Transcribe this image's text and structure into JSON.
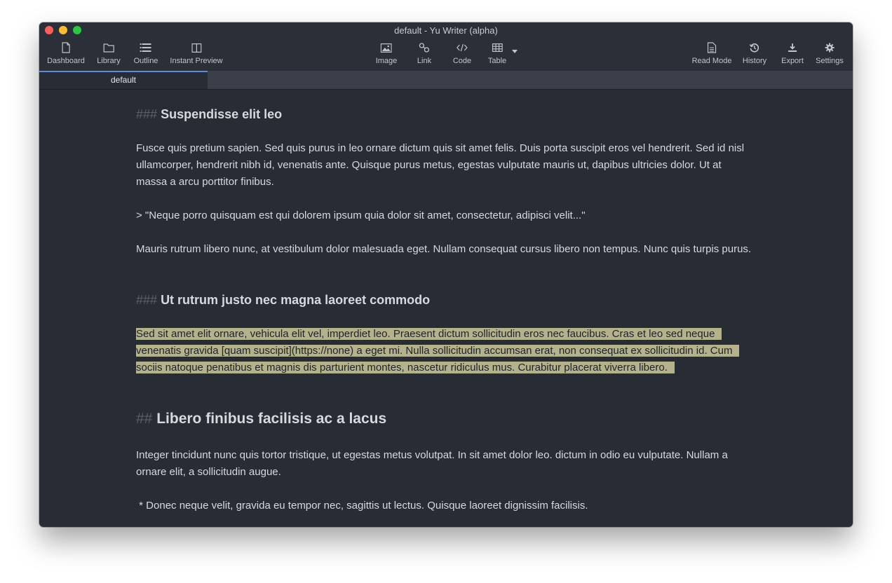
{
  "window": {
    "title": "default - Yu Writer (alpha)"
  },
  "toolbar": {
    "left": [
      {
        "label": "Dashboard",
        "icon": "document-icon"
      },
      {
        "label": "Library",
        "icon": "folder-icon"
      },
      {
        "label": "Outline",
        "icon": "list-icon"
      },
      {
        "label": "Instant Preview",
        "icon": "split-view-icon"
      }
    ],
    "center": [
      {
        "label": "Image",
        "icon": "image-icon"
      },
      {
        "label": "Link",
        "icon": "link-icon"
      },
      {
        "label": "Code",
        "icon": "code-icon"
      },
      {
        "label": "Table",
        "icon": "table-icon"
      }
    ],
    "right": [
      {
        "label": "Read Mode",
        "icon": "read-mode-icon"
      },
      {
        "label": "History",
        "icon": "history-icon"
      },
      {
        "label": "Export",
        "icon": "export-icon"
      },
      {
        "label": "Settings",
        "icon": "gear-icon"
      }
    ]
  },
  "tabs": [
    {
      "label": "default",
      "active": true
    }
  ],
  "document": {
    "h_suspendisse": {
      "marker": "###",
      "text": "Suspendisse elit leo"
    },
    "p1": "Fusce quis pretium sapien. Sed quis purus in leo ornare dictum quis sit amet felis. Duis porta suscipit eros vel hendrerit. Sed id nisl ullamcorper, hendrerit nibh id, venenatis ante. Quisque purus metus, egestas vulputate mauris ut, dapibus ultricies dolor. Ut at massa a arcu porttitor finibus.",
    "quote": "> \"Neque porro quisquam est qui dolorem ipsum quia dolor sit amet, consectetur, adipisci velit...\"",
    "p2": "Mauris rutrum libero nunc, at vestibulum dolor malesuada eget. Nullam consequat cursus libero non tempus. Nunc quis turpis purus.",
    "h_ut_rutrum": {
      "marker": "###",
      "text": "Ut rutrum justo nec magna laoreet commodo"
    },
    "p3": {
      "before": "Sed sit amet elit ornare, vehicula elit vel, imperdiet leo. Praesent dictum sollicitudin eros nec faucibus. Cras et leo sed neque venenatis gravida ",
      "link": "[quam suscipit](https://none)",
      "after": " a eget mi. Nulla sollicitudin accumsan erat, non consequat ex sollicitudin id. Cum sociis natoque penatibus et magnis dis parturient montes, nascetur ridiculus mus. Curabitur placerat viverra libero.",
      "selected": true
    },
    "h_libero": {
      "marker": "##",
      "text": "Libero finibus facilisis ac a lacus"
    },
    "p4": "Integer tincidunt nunc quis tortor tristique, ut egestas metus volutpat. In sit amet dolor leo. dictum in odio eu vulputate. Nullam a ornare elit, a sollicitudin augue.",
    "bullet": " * Donec neque velit, gravida eu tempor nec, sagittis ut lectus. Quisque laoreet dignissim facilisis."
  },
  "colors": {
    "editor_bg": "#282c34",
    "text": "#d6d9de",
    "markdown_marker": "#5b606b",
    "selection": "#b4b28a",
    "tab_accent": "#5c8ad8"
  }
}
